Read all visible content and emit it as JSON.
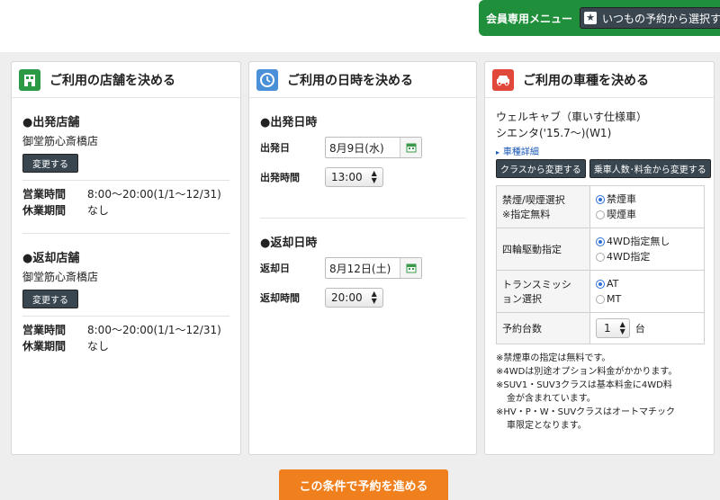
{
  "member": {
    "label": "会員専用メニュー",
    "button": "いつもの予約から選択する"
  },
  "store_panel": {
    "title": "ご利用の店舗を決める",
    "departure": {
      "heading": "●出発店舗",
      "store": "御堂筋心斎橋店",
      "change": "変更する",
      "hours_label": "営業時間",
      "hours_value": "8:00〜20:00(1/1〜12/31)",
      "closed_label": "休業期間",
      "closed_value": "なし"
    },
    "return": {
      "heading": "●返却店舗",
      "store": "御堂筋心斎橋店",
      "change": "変更する",
      "hours_label": "営業時間",
      "hours_value": "8:00〜20:00(1/1〜12/31)",
      "closed_label": "休業期間",
      "closed_value": "なし"
    }
  },
  "datetime_panel": {
    "title": "ご利用の日時を決める",
    "departure": {
      "heading": "●出発日時",
      "date_label": "出発日",
      "date_value": "8月9日(水)",
      "time_label": "出発時間",
      "time_value": "13:00"
    },
    "return": {
      "heading": "●返却日時",
      "date_label": "返却日",
      "date_value": "8月12日(土)",
      "time_label": "返却時間",
      "time_value": "20:00"
    }
  },
  "car_panel": {
    "title": "ご利用の車種を決める",
    "car_name_1": "ウェルキャブ（車いす仕様車）",
    "car_name_2": "シエンタ('15.7〜)(W1)",
    "detail_link": "車種詳細",
    "class_button": "クラスから変更する",
    "people_button": "乗車人数･料金から変更する",
    "smoking_label_1": "禁煙/喫煙選択",
    "smoking_label_2": "※指定無料",
    "smoking_opt_1": "禁煙車",
    "smoking_opt_2": "喫煙車",
    "awd_label": "四輪駆動指定",
    "awd_opt_1": "4WD指定無し",
    "awd_opt_2": "4WD指定",
    "trans_label_1": "トランスミッシ",
    "trans_label_2": "ョン選択",
    "trans_opt_1": "AT",
    "trans_opt_2": "MT",
    "count_label": "予約台数",
    "count_value": "1",
    "count_unit": "台",
    "note_1": "※禁煙車の指定は無料です。",
    "note_2": "※4WDは別途オプション料金がかかります。",
    "note_3a": "※SUV1・SUV3クラスは基本料金に4WD料",
    "note_3b": "金が含まれています。",
    "note_4a": "※HV・P・W・SUVクラスはオートマチック",
    "note_4b": "車限定となります。"
  },
  "submit": "この条件で予約を進める"
}
